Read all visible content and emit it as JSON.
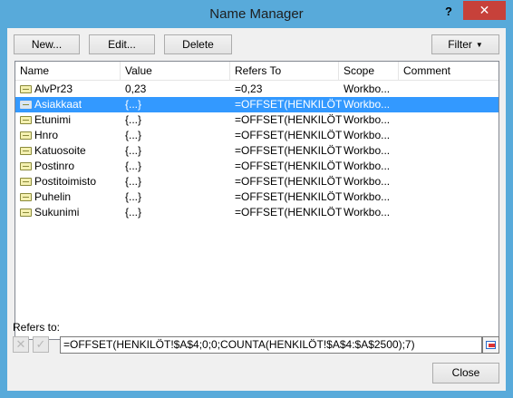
{
  "window": {
    "title": "Name Manager",
    "help_glyph": "?",
    "close_glyph": "✕"
  },
  "toolbar": {
    "new_label": "New...",
    "edit_label": "Edit...",
    "delete_label": "Delete",
    "filter_label": "Filter"
  },
  "columns": {
    "name": "Name",
    "value": "Value",
    "refers_to": "Refers To",
    "scope": "Scope",
    "comment": "Comment"
  },
  "rows": [
    {
      "name": "AlvPr23",
      "value": "0,23",
      "refers_to": "=0,23",
      "scope": "Workbo...",
      "comment": ""
    },
    {
      "name": "Asiakkaat",
      "value": "{...}",
      "refers_to": "=OFFSET(HENKILÖT!...",
      "scope": "Workbo...",
      "comment": "",
      "selected": true
    },
    {
      "name": "Etunimi",
      "value": "{...}",
      "refers_to": "=OFFSET(HENKILÖT!...",
      "scope": "Workbo...",
      "comment": ""
    },
    {
      "name": "Hnro",
      "value": "{...}",
      "refers_to": "=OFFSET(HENKILÖT!...",
      "scope": "Workbo...",
      "comment": ""
    },
    {
      "name": "Katuosoite",
      "value": "{...}",
      "refers_to": "=OFFSET(HENKILÖT!...",
      "scope": "Workbo...",
      "comment": ""
    },
    {
      "name": "Postinro",
      "value": "{...}",
      "refers_to": "=OFFSET(HENKILÖT!...",
      "scope": "Workbo...",
      "comment": ""
    },
    {
      "name": "Postitoimisto",
      "value": "{...}",
      "refers_to": "=OFFSET(HENKILÖT!...",
      "scope": "Workbo...",
      "comment": ""
    },
    {
      "name": "Puhelin",
      "value": "{...}",
      "refers_to": "=OFFSET(HENKILÖT!...",
      "scope": "Workbo...",
      "comment": ""
    },
    {
      "name": "Sukunimi",
      "value": "{...}",
      "refers_to": "=OFFSET(HENKILÖT!...",
      "scope": "Workbo...",
      "comment": ""
    }
  ],
  "refers": {
    "label": "Refers to:",
    "value": "=OFFSET(HENKILÖT!$A$4;0;0;COUNTA(HENKILÖT!$A$4:$A$2500);7)",
    "cancel_glyph": "✕",
    "confirm_glyph": "✓"
  },
  "footer": {
    "close_label": "Close"
  },
  "colors": {
    "title_bar": "#58aada",
    "close_button": "#c7413a",
    "selection": "#3399ff"
  }
}
